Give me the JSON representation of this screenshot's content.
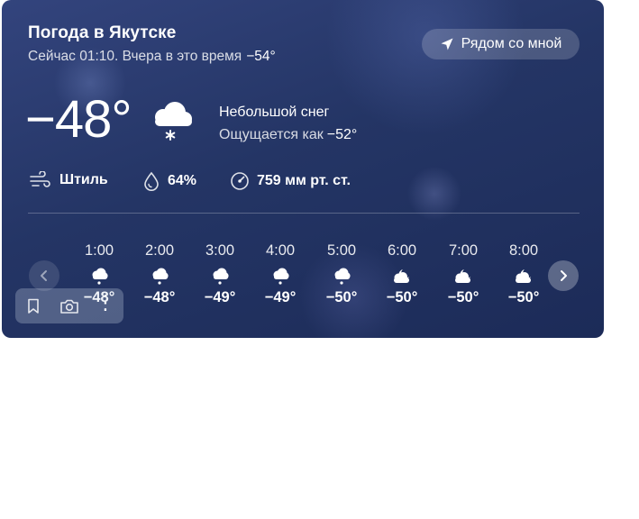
{
  "header": {
    "title": "Погода в Якутске",
    "now_text": "Сейчас 01:10. Вчера в это время",
    "yesterday_temp": "−54°",
    "near_button": "Рядом со мной"
  },
  "current": {
    "temp": "−48°",
    "condition": "Небольшой снег",
    "feels_label": "Ощущается как",
    "feels_temp": "−52°",
    "icon": "cloud-snow-icon"
  },
  "metrics": {
    "wind": "Штиль",
    "humidity": "64%",
    "pressure": "759 мм рт. ст."
  },
  "hourly": [
    {
      "time": "1:00",
      "temp": "−48°",
      "icon": "cloud-snow-icon"
    },
    {
      "time": "2:00",
      "temp": "−48°",
      "icon": "cloud-snow-icon"
    },
    {
      "time": "3:00",
      "temp": "−49°",
      "icon": "cloud-snow-icon"
    },
    {
      "time": "4:00",
      "temp": "−49°",
      "icon": "cloud-snow-icon"
    },
    {
      "time": "5:00",
      "temp": "−50°",
      "icon": "cloud-snow-icon"
    },
    {
      "time": "6:00",
      "temp": "−50°",
      "icon": "cloud-moon-icon"
    },
    {
      "time": "7:00",
      "temp": "−50°",
      "icon": "cloud-moon-icon"
    },
    {
      "time": "8:00",
      "temp": "−50°",
      "icon": "cloud-moon-icon"
    }
  ],
  "tools": {
    "more_label": "⋮"
  }
}
